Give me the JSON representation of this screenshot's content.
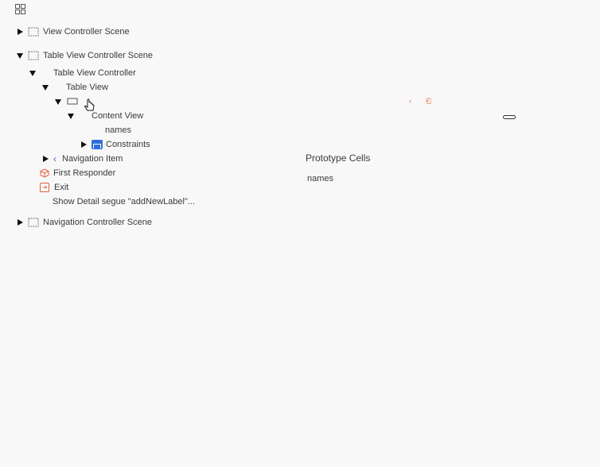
{
  "outline": {
    "view_controller_scene": "View Controller Scene",
    "table_view_controller_scene": "Table View Controller Scene",
    "table_view_controller": "Table View Controller",
    "table_view": "Table View",
    "content_view": "Content View",
    "names_label": "names",
    "constraints": "Constraints",
    "navigation_item": "Navigation Item",
    "first_responder": "First Responder",
    "exit": "Exit",
    "show_detail_segue": "Show Detail segue \"addNewLabel\"...",
    "navigation_controller_scene": "Navigation Controller Scene"
  },
  "canvas": {
    "prototype_cells": "Prototype Cells",
    "cell_label": "names"
  },
  "icons": {
    "grid": "grid-icon",
    "scene": "scene-icon",
    "navigation_item": "chevron-left-icon",
    "first_responder": "cube-icon",
    "exit": "exit-icon",
    "constraints": "constraints-icon",
    "cell": "table-cell-icon",
    "cursor": "pointer-hand-icon"
  },
  "colors": {
    "background": "#f8f8f8",
    "accent_blue": "#2f6bd8",
    "accent_orange": "#e55e3a"
  }
}
